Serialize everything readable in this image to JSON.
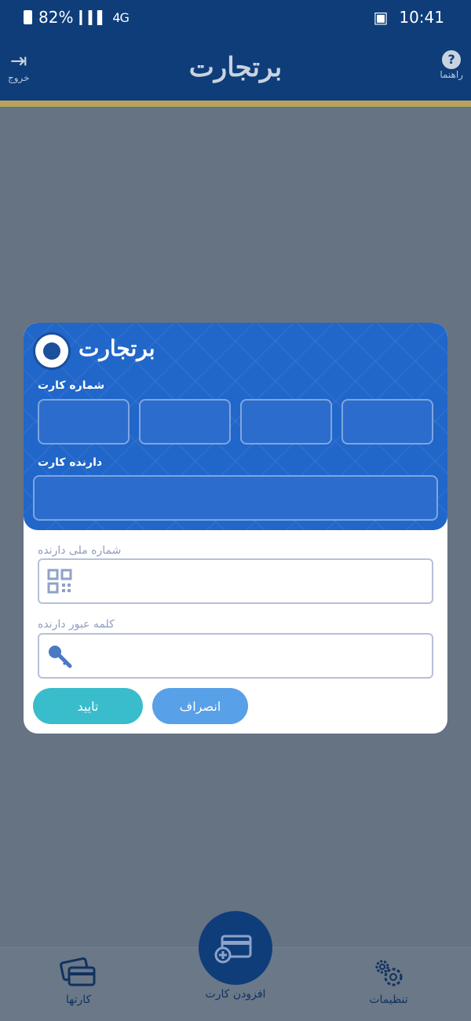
{
  "status_bar": {
    "time": "10:41",
    "battery": "82%",
    "network": "4G"
  },
  "header": {
    "logo": "برتجارت",
    "exit_label": "خروج",
    "help_label": "راهنما"
  },
  "dialog": {
    "card_logo": "برتجارت",
    "card_number_label": "شماره کارت",
    "card_holder_label": "دارنده کارت",
    "national_id_label": "شماره ملی دارنده",
    "national_id_value": "",
    "password_label": "کلمه عبور دارنده",
    "password_value": "",
    "confirm_button": "تایید",
    "cancel_button": "انصراف"
  },
  "bottom_nav": {
    "cards_label": "کارتها",
    "add_card_label": "افزودن کارت",
    "settings_label": "تنظیمات"
  },
  "colors": {
    "header_bg": "#0e3d7a",
    "card_blue": "#2166c9",
    "confirm_teal": "#39bccb",
    "cancel_blue": "#58a0e8",
    "overlay": "#657383"
  },
  "icons": {
    "exit": "exit-icon",
    "help": "help-icon",
    "national_id": "qr-icon",
    "password": "key-icon",
    "cards": "cards-icon",
    "add_card": "add-card-icon",
    "settings": "gear-icon"
  }
}
